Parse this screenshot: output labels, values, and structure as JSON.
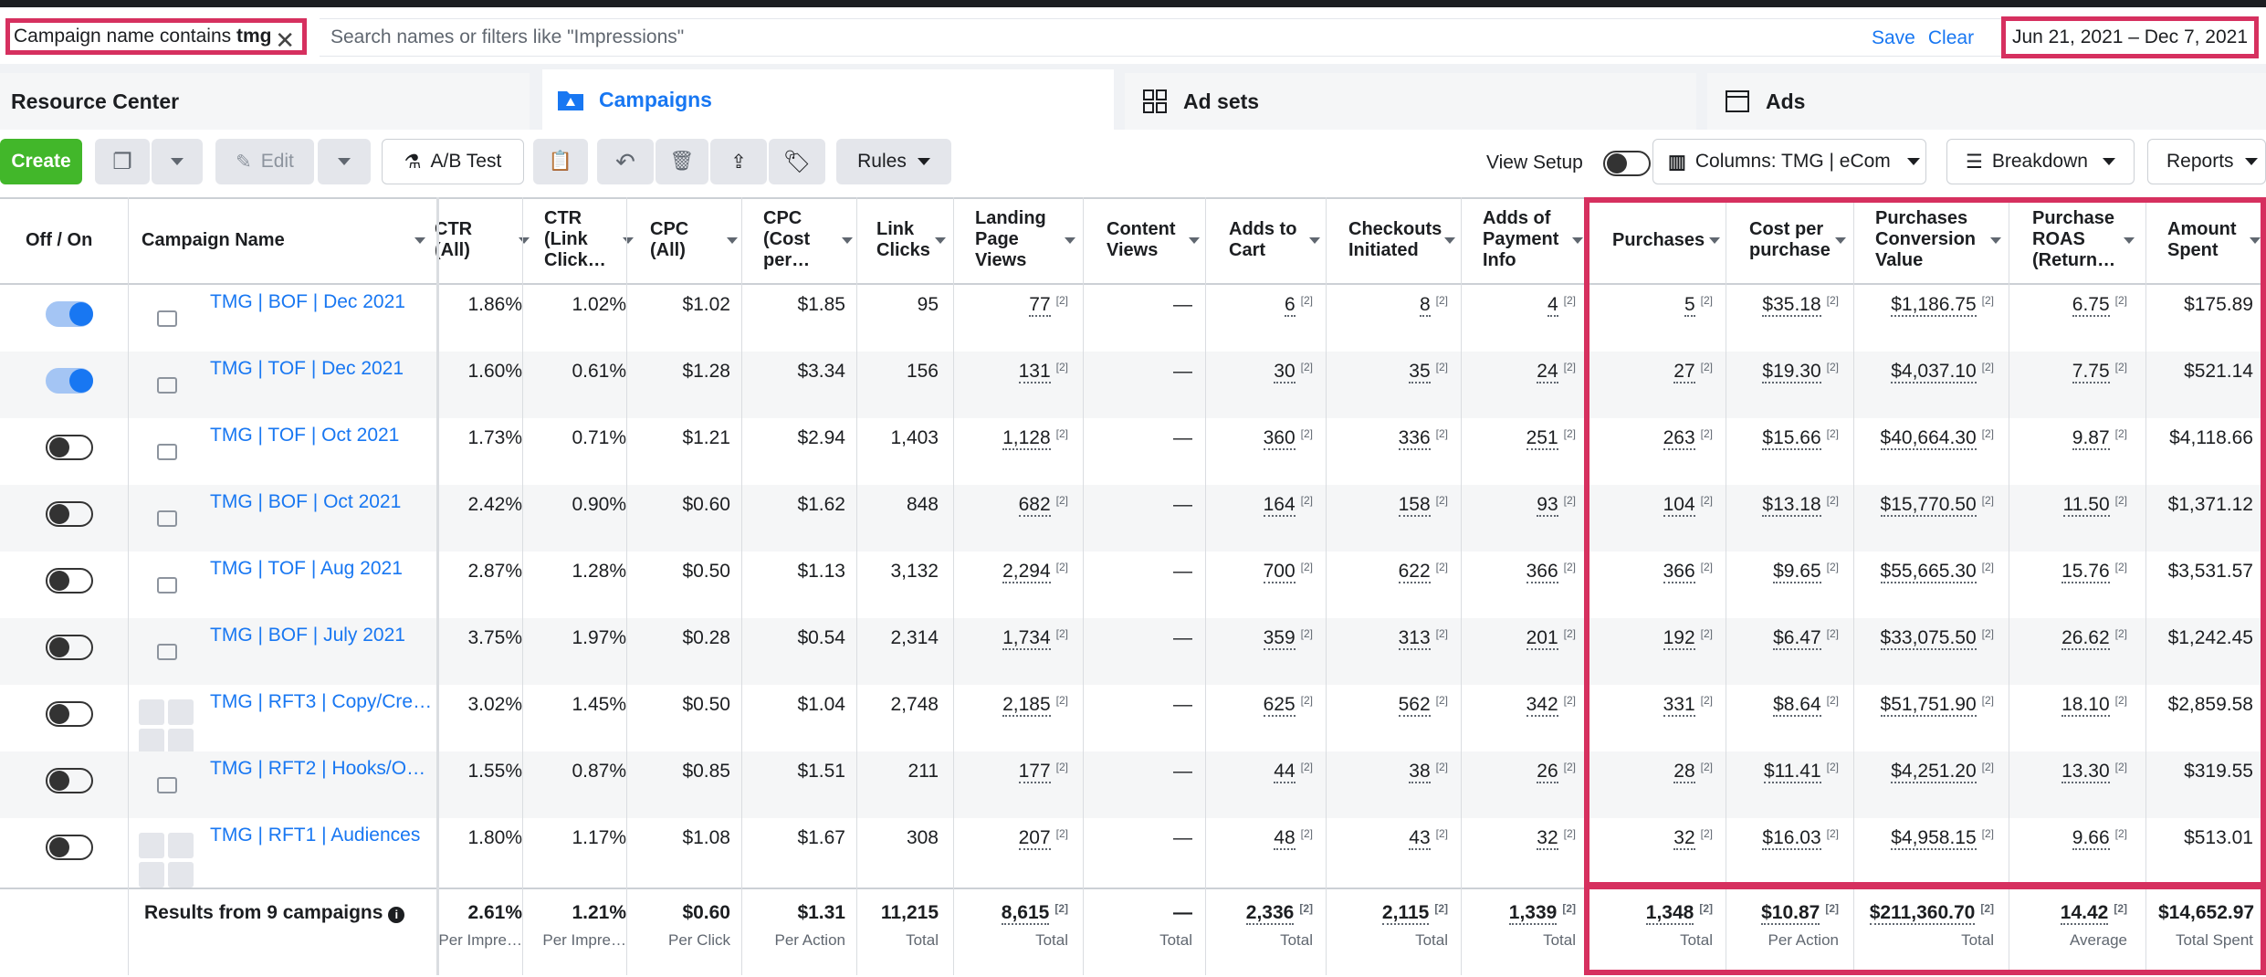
{
  "filter": {
    "chip_prefix": "Campaign name contains ",
    "chip_value": "tmg",
    "search_placeholder": "Search names or filters like \"Impressions\"",
    "save": "Save",
    "clear": "Clear",
    "date_range": "Jun 21, 2021 – Dec 7, 2021"
  },
  "tabs": {
    "resource_center": "Resource Center",
    "campaigns": "Campaigns",
    "ad_sets": "Ad sets",
    "ads": "Ads"
  },
  "toolbar": {
    "create": "Create",
    "edit": "Edit",
    "ab_test": "A/B Test",
    "rules": "Rules",
    "view_setup": "View Setup",
    "columns": "Columns: TMG | eCom",
    "breakdown": "Breakdown",
    "reports": "Reports"
  },
  "headers": {
    "off_on": "Off / On",
    "campaign_name": "Campaign Name",
    "ctr_all": [
      "CTR",
      "(All)"
    ],
    "ctr_link": [
      "CTR",
      "(Link",
      "Click…"
    ],
    "cpc_all": [
      "CPC",
      "(All)"
    ],
    "cpc_cost": [
      "CPC",
      "(Cost",
      "per…"
    ],
    "link_clicks": [
      "Link",
      "Clicks"
    ],
    "lpv": [
      "Landing",
      "Page",
      "Views"
    ],
    "content_views": [
      "Content",
      "Views"
    ],
    "adds_to_cart": [
      "Adds to",
      "Cart"
    ],
    "checkouts": [
      "Checkouts",
      "Initiated"
    ],
    "adds_payment": [
      "Adds of",
      "Payment",
      "Info"
    ],
    "purchases": [
      "Purchases"
    ],
    "cost_per_purchase": [
      "Cost per",
      "purchase"
    ],
    "purch_value": [
      "Purchases",
      "Conversion",
      "Value"
    ],
    "roas": [
      "Purchase",
      "ROAS",
      "(Return…"
    ],
    "amount_spent": [
      "Amount",
      "Spent"
    ]
  },
  "rows": [
    {
      "on": true,
      "thumb": "single",
      "name": "TMG | BOF | Dec 2021",
      "ctr_all": "1.86%",
      "ctr_link": "1.02%",
      "cpc_all": "$1.02",
      "cpc_cost": "$1.85",
      "link_clicks": "95",
      "lpv": "77",
      "cv": "—",
      "atc": "6",
      "ci": "8",
      "api": "4",
      "purch": "5",
      "cpp": "$35.18",
      "val": "$1,186.75",
      "roas": "6.75",
      "spent": "$175.89"
    },
    {
      "on": true,
      "thumb": "single",
      "name": "TMG | TOF | Dec 2021",
      "ctr_all": "1.60%",
      "ctr_link": "0.61%",
      "cpc_all": "$1.28",
      "cpc_cost": "$3.34",
      "link_clicks": "156",
      "lpv": "131",
      "cv": "—",
      "atc": "30",
      "ci": "35",
      "api": "24",
      "purch": "27",
      "cpp": "$19.30",
      "val": "$4,037.10",
      "roas": "7.75",
      "spent": "$521.14"
    },
    {
      "on": false,
      "thumb": "single",
      "name": "TMG | TOF | Oct 2021",
      "ctr_all": "1.73%",
      "ctr_link": "0.71%",
      "cpc_all": "$1.21",
      "cpc_cost": "$2.94",
      "link_clicks": "1,403",
      "lpv": "1,128",
      "cv": "—",
      "atc": "360",
      "ci": "336",
      "api": "251",
      "purch": "263",
      "cpp": "$15.66",
      "val": "$40,664.30",
      "roas": "9.87",
      "spent": "$4,118.66"
    },
    {
      "on": false,
      "thumb": "single",
      "name": "TMG | BOF | Oct 2021",
      "ctr_all": "2.42%",
      "ctr_link": "0.90%",
      "cpc_all": "$0.60",
      "cpc_cost": "$1.62",
      "link_clicks": "848",
      "lpv": "682",
      "cv": "—",
      "atc": "164",
      "ci": "158",
      "api": "93",
      "purch": "104",
      "cpp": "$13.18",
      "val": "$15,770.50",
      "roas": "11.50",
      "spent": "$1,371.12"
    },
    {
      "on": false,
      "thumb": "single",
      "name": "TMG | TOF | Aug 2021",
      "ctr_all": "2.87%",
      "ctr_link": "1.28%",
      "cpc_all": "$0.50",
      "cpc_cost": "$1.13",
      "link_clicks": "3,132",
      "lpv": "2,294",
      "cv": "—",
      "atc": "700",
      "ci": "622",
      "api": "366",
      "purch": "366",
      "cpp": "$9.65",
      "val": "$55,665.30",
      "roas": "15.76",
      "spent": "$3,531.57"
    },
    {
      "on": false,
      "thumb": "single",
      "name": "TMG | BOF | July 2021",
      "ctr_all": "3.75%",
      "ctr_link": "1.97%",
      "cpc_all": "$0.28",
      "cpc_cost": "$0.54",
      "link_clicks": "2,314",
      "lpv": "1,734",
      "cv": "—",
      "atc": "359",
      "ci": "313",
      "api": "201",
      "purch": "192",
      "cpp": "$6.47",
      "val": "$33,075.50",
      "roas": "26.62",
      "spent": "$1,242.45"
    },
    {
      "on": false,
      "thumb": "grid",
      "name": "TMG | RFT3 | Copy/Cre…",
      "ctr_all": "3.02%",
      "ctr_link": "1.45%",
      "cpc_all": "$0.50",
      "cpc_cost": "$1.04",
      "link_clicks": "2,748",
      "lpv": "2,185",
      "cv": "—",
      "atc": "625",
      "ci": "562",
      "api": "342",
      "purch": "331",
      "cpp": "$8.64",
      "val": "$51,751.90",
      "roas": "18.10",
      "spent": "$2,859.58"
    },
    {
      "on": false,
      "thumb": "single",
      "name": "TMG | RFT2 | Hooks/O…",
      "ctr_all": "1.55%",
      "ctr_link": "0.87%",
      "cpc_all": "$0.85",
      "cpc_cost": "$1.51",
      "link_clicks": "211",
      "lpv": "177",
      "cv": "—",
      "atc": "44",
      "ci": "38",
      "api": "26",
      "purch": "28",
      "cpp": "$11.41",
      "val": "$4,251.20",
      "roas": "13.30",
      "spent": "$319.55"
    },
    {
      "on": false,
      "thumb": "grid",
      "name": "TMG | RFT1 | Audiences",
      "ctr_all": "1.80%",
      "ctr_link": "1.17%",
      "cpc_all": "$1.08",
      "cpc_cost": "$1.67",
      "link_clicks": "308",
      "lpv": "207",
      "cv": "—",
      "atc": "48",
      "ci": "43",
      "api": "32",
      "purch": "32",
      "cpp": "$16.03",
      "val": "$4,958.15",
      "roas": "9.66",
      "spent": "$513.01"
    }
  ],
  "totals": {
    "label": "Results from 9 campaigns",
    "ctr_all": "2.61%",
    "ctr_all_sub": "Per Impre…",
    "ctr_link": "1.21%",
    "ctr_link_sub": "Per Impre…",
    "cpc_all": "$0.60",
    "cpc_all_sub": "Per Click",
    "cpc_cost": "$1.31",
    "cpc_cost_sub": "Per Action",
    "link_clicks": "11,215",
    "link_clicks_sub": "Total",
    "lpv": "8,615",
    "lpv_sub": "Total",
    "cv": "—",
    "cv_sub": "Total",
    "atc": "2,336",
    "atc_sub": "Total",
    "ci": "2,115",
    "ci_sub": "Total",
    "api": "1,339",
    "api_sub": "Total",
    "purch": "1,348",
    "purch_sub": "Total",
    "cpp": "$10.87",
    "cpp_sub": "Per Action",
    "val": "$211,360.70",
    "val_sub": "Total",
    "roas": "14.42",
    "roas_sub": "Average",
    "spent": "$14,652.97",
    "spent_sub": "Total Spent"
  },
  "superscript": "[2]",
  "colors": {
    "accent": "#1877f2",
    "highlight": "#d6305f",
    "create": "#42b72a"
  }
}
